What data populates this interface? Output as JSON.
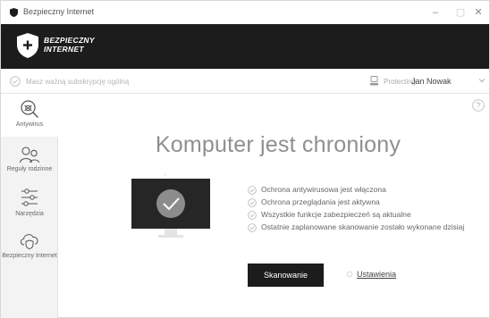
{
  "window": {
    "title": "Bezpieczny Internet",
    "minimize_glyph": "–",
    "maximize_glyph": "▢",
    "close_glyph": "✕"
  },
  "brand": {
    "line1": "BEZPIECZNY",
    "line2": "INTERNET"
  },
  "subscription": {
    "text": "Masz ważną subskrypcję ogólną",
    "protecting_label": "Protecting",
    "protecting_user": "Jan Nowak"
  },
  "sidebar": {
    "items": [
      {
        "label": "Antywirus",
        "icon": "antivirus-icon"
      },
      {
        "label": "Reguły rodzinne",
        "icon": "family-rules-icon"
      },
      {
        "label": "Narzędzia",
        "icon": "tools-icon"
      },
      {
        "label": "Bezpieczny Internet",
        "icon": "safe-internet-icon"
      }
    ]
  },
  "main": {
    "headline": "Komputer jest chroniony",
    "statuses": [
      "Ochrona antywirusowa jest włączona",
      "Ochrona przeglądania jest aktywna",
      "Wszystkie funkcje zabezpieczeń są aktualne",
      "Ostatnie zaplanowane skanowanie zostało wykonane dzisiaj"
    ],
    "scan_button": "Skanowanie",
    "settings_link": "Ustawienia"
  },
  "colors": {
    "brand_dark": "#1c1c1c",
    "monitor_screen": "#262626",
    "status_check": "#bdbdbd"
  }
}
